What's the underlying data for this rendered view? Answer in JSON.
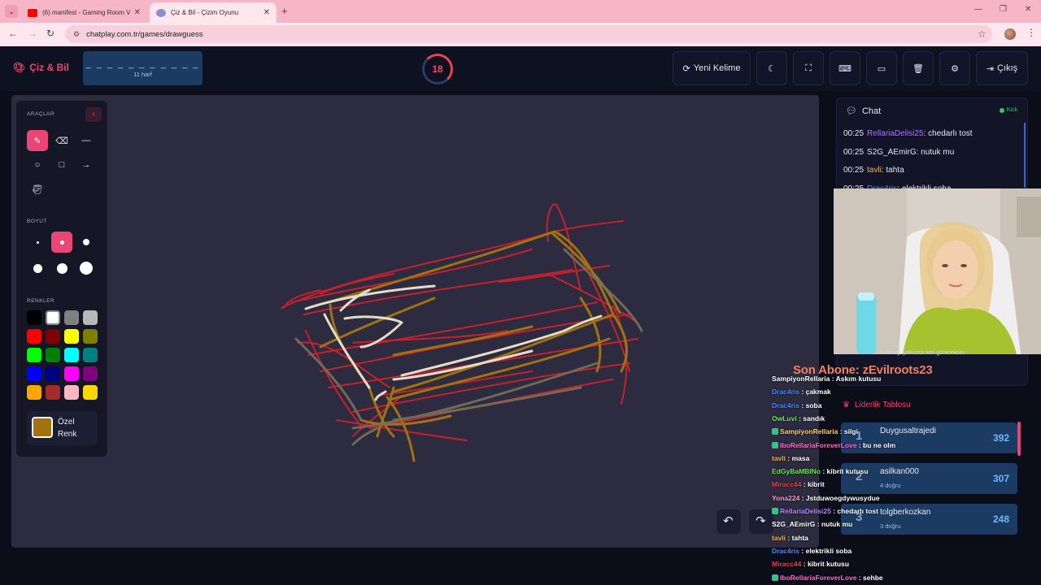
{
  "browser": {
    "tabs": [
      {
        "title": "(6) manifest - Gaming Room V",
        "active": false
      },
      {
        "title": "Çiz & Bil - Çizim Oyunu",
        "active": true
      }
    ],
    "url": "chatplay.com.tr/games/drawguess"
  },
  "header": {
    "logo": "Çiz & Bil",
    "word_dashes": "_ _ _ _ _ _ _ _ _ _ _",
    "word_hint": "11 harf",
    "timer": "18",
    "new_word_label": "Yeni Kelime",
    "exit_label": "Çıkış"
  },
  "tools": {
    "tools_label": "ARAÇLAR",
    "size_label": "BOYUT",
    "colors_label": "RENKLER",
    "custom_color_label": "Özel Renk",
    "custom_color_line1": "Özel",
    "custom_color_line2": "Renk",
    "selected_tool": "brush",
    "selected_size_index": 1,
    "custom_color": "#a07310",
    "palette": [
      "#000000",
      "#ffffff",
      "#808080",
      "#b8b8b8",
      "#ff0000",
      "#800000",
      "#ffff00",
      "#808000",
      "#00ff00",
      "#008000",
      "#00ffff",
      "#008080",
      "#0000ff",
      "#000080",
      "#ff00ff",
      "#800080",
      "#ffa500",
      "#a52a2a",
      "#ffb6c1",
      "#ffd700"
    ]
  },
  "chat": {
    "title": "Chat",
    "platform": "Kick",
    "messages": [
      {
        "time": "00:25",
        "user": "RellariaDelisi25",
        "text": "chedarlı tost",
        "color": "#a977ff"
      },
      {
        "time": "00:25",
        "user": "S2G_AEmirG",
        "text": "nutuk mu",
        "color": "#e6e8f2"
      },
      {
        "time": "00:25",
        "user": "tavli",
        "text": "tahta",
        "color": "#f0b74a"
      },
      {
        "time": "00:25",
        "user": "Drac4ris",
        "text": "elektrikli soba",
        "color": "#4a8cff"
      }
    ],
    "webcam_note": "Kelimeyi yalnızca sen göreceksin."
  },
  "subscriber": "Son Abone: zEvilroots23",
  "leaderboard": {
    "title": "Liderlik Tablosu",
    "rows": [
      {
        "rank": "1",
        "name": "Duygusaltrajedi",
        "sub": "",
        "score": "392"
      },
      {
        "rank": "2",
        "name": "asilkan000",
        "sub": "4 doğru",
        "score": "307"
      },
      {
        "rank": "3",
        "name": "tolgberkozkan",
        "sub": "3 doğru",
        "score": "248"
      }
    ]
  },
  "overlay_chat": [
    {
      "user": "SampiyonRellaria",
      "text": "Askım kutusu",
      "color": "#ffffff",
      "badge": false
    },
    {
      "user": "Drac4ris",
      "text": "çakmak",
      "color": "#4a8cff",
      "badge": false
    },
    {
      "user": "Drac4ris",
      "text": "soba",
      "color": "#4a8cff",
      "badge": false
    },
    {
      "user": "OwLuvi",
      "text": "sandık",
      "color": "#74e35a",
      "badge": false
    },
    {
      "user": "SampiyonRellaria",
      "text": "silgi",
      "color": "#ffd36a",
      "badge": true
    },
    {
      "user": "IboRellariaForeverLove",
      "text": "bu ne olm",
      "color": "#ff6bd0",
      "badge": true
    },
    {
      "user": "tavli",
      "text": "masa",
      "color": "#f0b74a",
      "badge": false
    },
    {
      "user": "EdGyBaMBINo",
      "text": "kibrit kutusu",
      "color": "#74e35a",
      "badge": false
    },
    {
      "user": "Miracc44",
      "text": "kibrit",
      "color": "#ff3b3b",
      "badge": false
    },
    {
      "user": "Yona224",
      "text": "Jstduwoegdywusydue",
      "color": "#ff9bd6",
      "badge": false
    },
    {
      "user": "RellariaDelisi25",
      "text": "chedarlı tost",
      "color": "#b48cff",
      "badge": true
    },
    {
      "user": "S2G_AEmirG",
      "text": "nutuk mu",
      "color": "#ffffff",
      "badge": false
    },
    {
      "user": "tavli",
      "text": "tahta",
      "color": "#f0b74a",
      "badge": false
    },
    {
      "user": "Drac4ris",
      "text": "elektrikli soba",
      "color": "#4a8cff",
      "badge": false
    },
    {
      "user": "Miracc44",
      "text": "kibrit kutusu",
      "color": "#ff3b3b",
      "badge": false
    },
    {
      "user": "IboRellariaForeverLove",
      "text": "sehbe",
      "color": "#ff6bd0",
      "badge": true
    }
  ]
}
